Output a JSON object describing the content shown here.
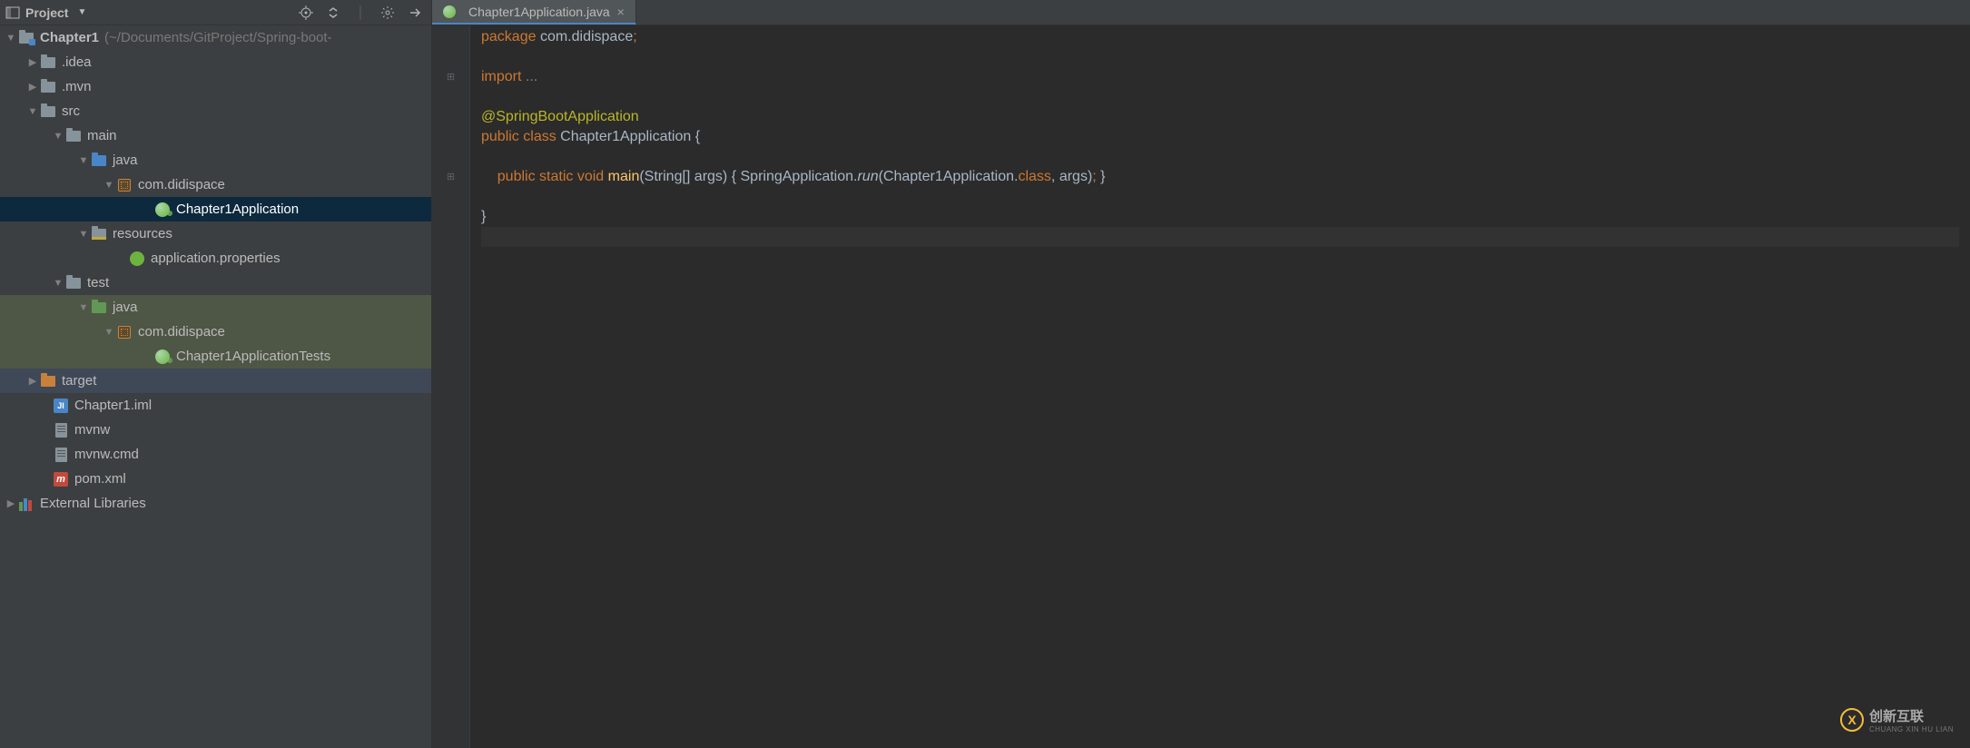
{
  "sidebar": {
    "title": "Project",
    "root": {
      "label": "Chapter1",
      "path": "(~/Documents/GitProject/Spring-boot-"
    },
    "items": {
      "idea": ".idea",
      "mvn": ".mvn",
      "src": "src",
      "main": "main",
      "java_main": "java",
      "pkg_main": "com.didispace",
      "app_class": "Chapter1Application",
      "resources": "resources",
      "app_props": "application.properties",
      "test": "test",
      "java_test": "java",
      "pkg_test": "com.didispace",
      "test_class": "Chapter1ApplicationTests",
      "target": "target",
      "iml": "Chapter1.iml",
      "mvnw": "mvnw",
      "mvnw_cmd": "mvnw.cmd",
      "pom": "pom.xml",
      "ext_libs": "External Libraries"
    }
  },
  "tab": {
    "filename": "Chapter1Application.java"
  },
  "code": {
    "pkg_kw": "package",
    "pkg_name": " com.didispace",
    "semi": ";",
    "import_kw": "import",
    "import_rest": " ...",
    "anno": "@SpringBootApplication",
    "pub": "public",
    "cls": "class",
    "clsname": "Chapter1Application",
    "ob": " {",
    "stat": "static",
    "void": "void",
    "main": "main",
    "main_args": "(String[] args)",
    "body_open": " { ",
    "sa": "SpringApplication.",
    "run": "run",
    "run_args_a": "(Chapter1Application.",
    "classkw": "class",
    "run_args_b": ", args)",
    "body_close": " }",
    "cb": "}"
  },
  "watermark": {
    "cn": "创新互联",
    "en": "CHUANG XIN HU LIAN"
  }
}
